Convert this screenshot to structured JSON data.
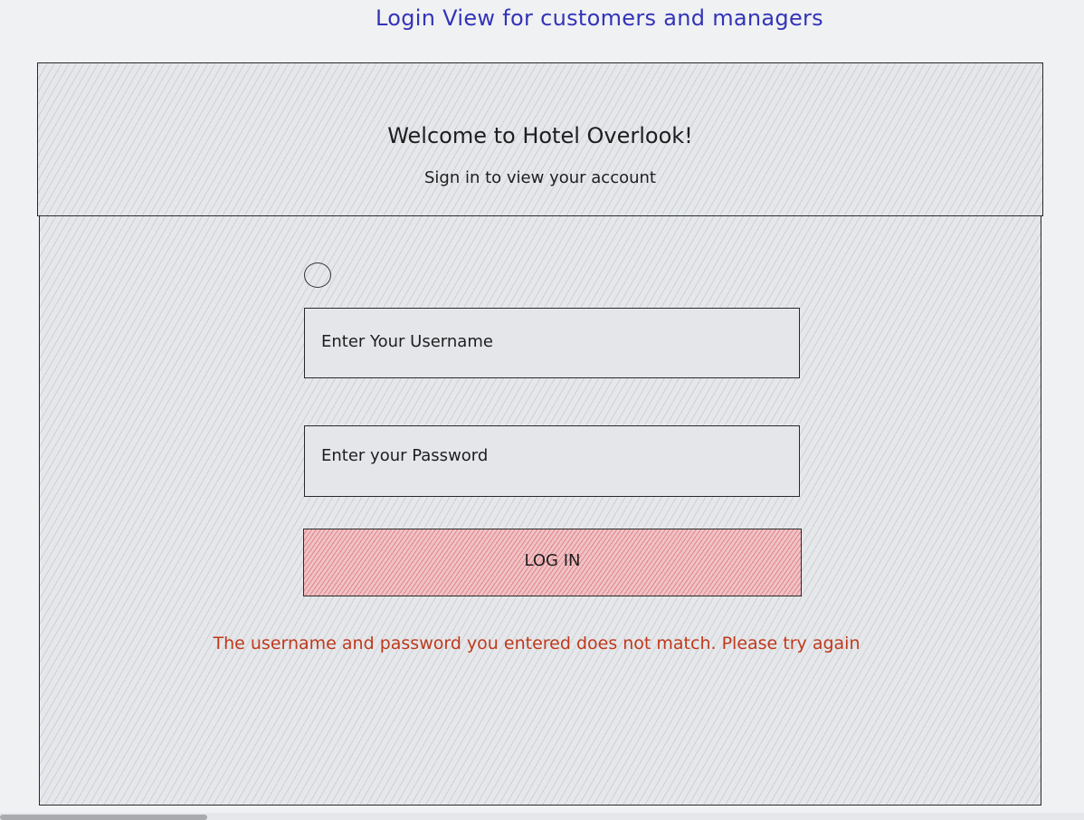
{
  "wireframe": {
    "title": "Login View for customers and managers"
  },
  "header": {
    "welcome": "Welcome to Hotel Overlook!",
    "subtitle": "Sign in to view your account"
  },
  "form": {
    "username_placeholder": "Enter Your Username",
    "password_placeholder": "Enter your Password",
    "login_label": "LOG IN",
    "error_message": "The username and password you entered does not match. Please try again"
  },
  "colors": {
    "title": "#3333b8",
    "error": "#c0391b",
    "button_fill": "#f0c3c6",
    "button_hatch": "#d2505a"
  },
  "icons": {
    "avatar": "circle-icon"
  }
}
